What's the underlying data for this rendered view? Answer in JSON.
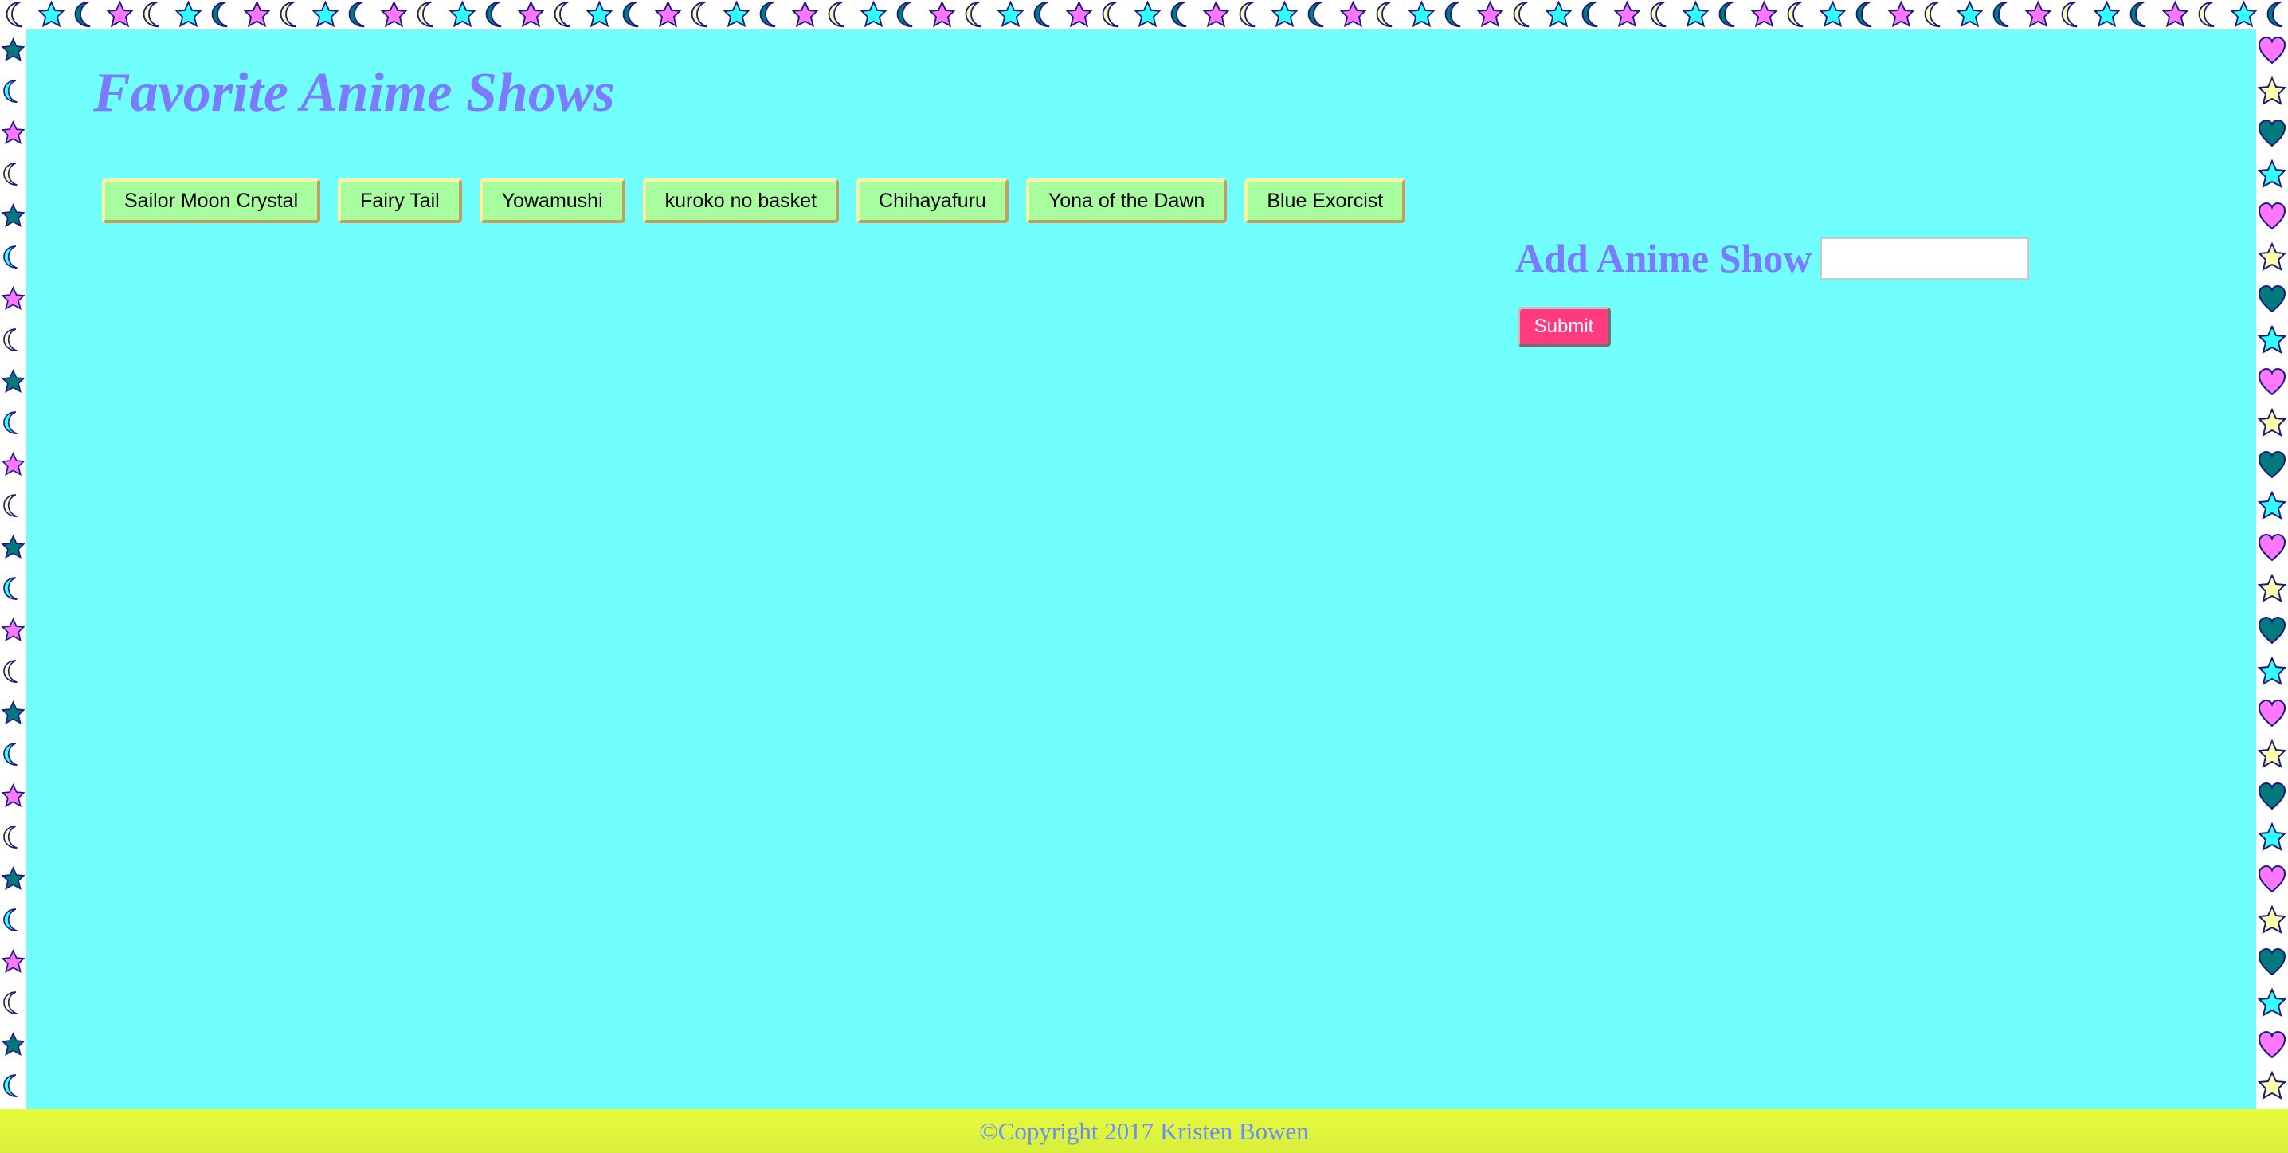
{
  "header": {
    "title": "Favorite Anime Shows"
  },
  "shows": [
    {
      "label": "Sailor Moon Crystal"
    },
    {
      "label": "Fairy Tail"
    },
    {
      "label": "Yowamushi"
    },
    {
      "label": "kuroko no basket"
    },
    {
      "label": "Chihayafuru"
    },
    {
      "label": "Yona of the Dawn"
    },
    {
      "label": "Blue Exorcist"
    }
  ],
  "add_form": {
    "label": "Add Anime Show",
    "input_value": "",
    "submit_label": "Submit"
  },
  "footer": {
    "text": "©Copyright 2017 Kristen Bowen"
  },
  "colors": {
    "background": "#70fffc",
    "title": "#7b7bff",
    "show_button": "#a8fd9e",
    "submit_button": "#ff3a7e",
    "footer": "#e6fb3e",
    "footer_text": "#6a8cff"
  },
  "border": {
    "top_pattern": [
      {
        "icon": "moon",
        "color": "#ffffaa"
      },
      {
        "icon": "star",
        "color": "#33ffff"
      },
      {
        "icon": "moon",
        "color": "#007a7a"
      },
      {
        "icon": "star",
        "color": "#ff77ff"
      }
    ],
    "left_pattern": [
      {
        "icon": "star",
        "color": "#007a7a"
      },
      {
        "icon": "moon",
        "color": "#33ffff"
      },
      {
        "icon": "star",
        "color": "#ff77ff"
      },
      {
        "icon": "moon",
        "color": "#ffffaa"
      }
    ],
    "right_pattern": [
      {
        "icon": "heart",
        "color": "#ff77ff"
      },
      {
        "icon": "star",
        "color": "#ffffaa"
      },
      {
        "icon": "heart",
        "color": "#007a7a"
      },
      {
        "icon": "star",
        "color": "#33ffff"
      }
    ]
  }
}
